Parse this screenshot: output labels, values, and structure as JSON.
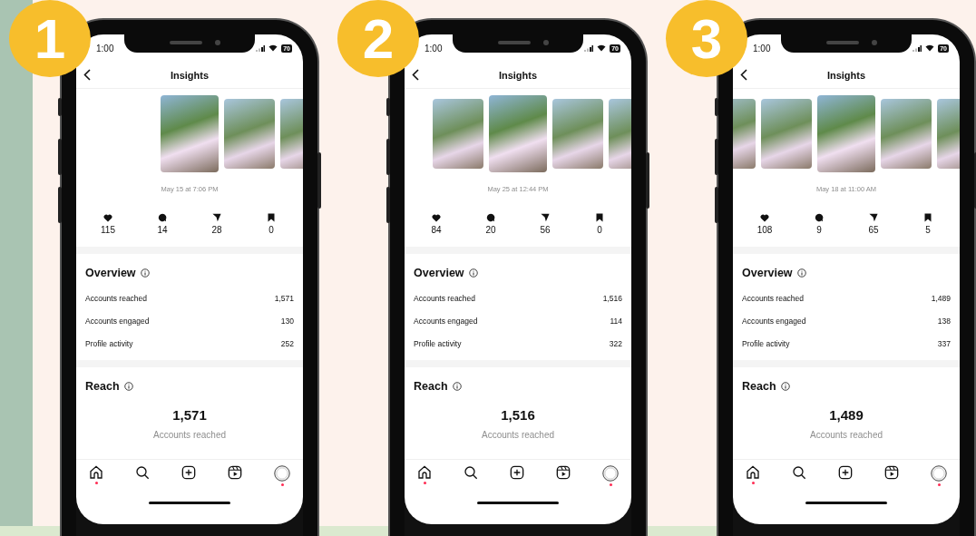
{
  "phones": [
    {
      "badge": "1",
      "time": "1:00",
      "battery": "70",
      "title": "Insights",
      "thumbnails": [
        {
          "selected": true
        },
        {
          "selected": false
        },
        {
          "selected": false
        }
      ],
      "date": "May 15 at 7:06 PM",
      "stats": [
        {
          "kind": "like",
          "value": "115"
        },
        {
          "kind": "comment",
          "value": "14"
        },
        {
          "kind": "share",
          "value": "28"
        },
        {
          "kind": "save",
          "value": "0"
        }
      ],
      "overview": {
        "title": "Overview",
        "rows": [
          {
            "label": "Accounts reached",
            "value": "1,571"
          },
          {
            "label": "Accounts engaged",
            "value": "130"
          },
          {
            "label": "Profile activity",
            "value": "252"
          }
        ]
      },
      "reach": {
        "title": "Reach",
        "value": "1,571",
        "label": "Accounts reached"
      },
      "nav": [
        {
          "kind": "home",
          "dot": true
        },
        {
          "kind": "search",
          "dot": false
        },
        {
          "kind": "create",
          "dot": false
        },
        {
          "kind": "reels",
          "dot": false
        },
        {
          "kind": "profile",
          "dot": true
        }
      ]
    },
    {
      "badge": "2",
      "time": "1:00",
      "battery": "70",
      "title": "Insights",
      "thumbnails": [
        {
          "selected": false
        },
        {
          "selected": true
        },
        {
          "selected": false
        },
        {
          "selected": false
        }
      ],
      "date": "May 25 at 12:44 PM",
      "stats": [
        {
          "kind": "like",
          "value": "84"
        },
        {
          "kind": "comment",
          "value": "20"
        },
        {
          "kind": "share",
          "value": "56"
        },
        {
          "kind": "save",
          "value": "0"
        }
      ],
      "overview": {
        "title": "Overview",
        "rows": [
          {
            "label": "Accounts reached",
            "value": "1,516"
          },
          {
            "label": "Accounts engaged",
            "value": "114"
          },
          {
            "label": "Profile activity",
            "value": "322"
          }
        ]
      },
      "reach": {
        "title": "Reach",
        "value": "1,516",
        "label": "Accounts reached"
      },
      "nav": [
        {
          "kind": "home",
          "dot": true
        },
        {
          "kind": "search",
          "dot": false
        },
        {
          "kind": "create",
          "dot": false
        },
        {
          "kind": "reels",
          "dot": false
        },
        {
          "kind": "profile",
          "dot": true
        }
      ]
    },
    {
      "badge": "3",
      "time": "1:00",
      "battery": "70",
      "title": "Insights",
      "thumbnails": [
        {
          "selected": false
        },
        {
          "selected": false
        },
        {
          "selected": true
        },
        {
          "selected": false
        },
        {
          "selected": false
        }
      ],
      "date": "May 18 at 11:00 AM",
      "stats": [
        {
          "kind": "like",
          "value": "108"
        },
        {
          "kind": "comment",
          "value": "9"
        },
        {
          "kind": "share",
          "value": "65"
        },
        {
          "kind": "save",
          "value": "5"
        }
      ],
      "overview": {
        "title": "Overview",
        "rows": [
          {
            "label": "Accounts reached",
            "value": "1,489"
          },
          {
            "label": "Accounts engaged",
            "value": "138"
          },
          {
            "label": "Profile activity",
            "value": "337"
          }
        ]
      },
      "reach": {
        "title": "Reach",
        "value": "1,489",
        "label": "Accounts reached"
      },
      "nav": [
        {
          "kind": "home",
          "dot": true
        },
        {
          "kind": "search",
          "dot": false
        },
        {
          "kind": "create",
          "dot": false
        },
        {
          "kind": "reels",
          "dot": false
        },
        {
          "kind": "profile",
          "dot": true
        }
      ]
    }
  ]
}
